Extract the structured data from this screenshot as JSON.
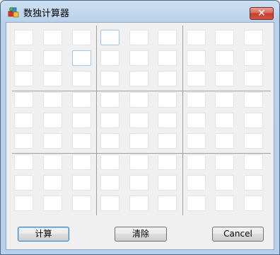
{
  "window": {
    "title": "数独计算器",
    "close_label": "✕"
  },
  "grid": {
    "rows": 9,
    "cols": 9,
    "values": [
      [
        "",
        "",
        "",
        "",
        "",
        "",
        "",
        "",
        ""
      ],
      [
        "",
        "",
        "",
        "",
        "",
        "",
        "",
        "",
        ""
      ],
      [
        "",
        "",
        "",
        "",
        "",
        "",
        "",
        "",
        ""
      ],
      [
        "",
        "",
        "",
        "",
        "",
        "",
        "",
        "",
        ""
      ],
      [
        "",
        "",
        "",
        "",
        "",
        "",
        "",
        "",
        ""
      ],
      [
        "",
        "",
        "",
        "",
        "",
        "",
        "",
        "",
        ""
      ],
      [
        "",
        "",
        "",
        "",
        "",
        "",
        "",
        "",
        ""
      ],
      [
        "",
        "",
        "",
        "",
        "",
        "",
        "",
        "",
        ""
      ],
      [
        "",
        "",
        "",
        "",
        "",
        "",
        "",
        "",
        ""
      ]
    ]
  },
  "buttons": {
    "calculate_label": "计算",
    "clear_label": "清除",
    "cancel_label": "Cancel"
  },
  "colors": {
    "close_button": "#c73d2c",
    "default_button_border": "#3c7fb1",
    "cell_focus_border": "#9ec5ea"
  }
}
